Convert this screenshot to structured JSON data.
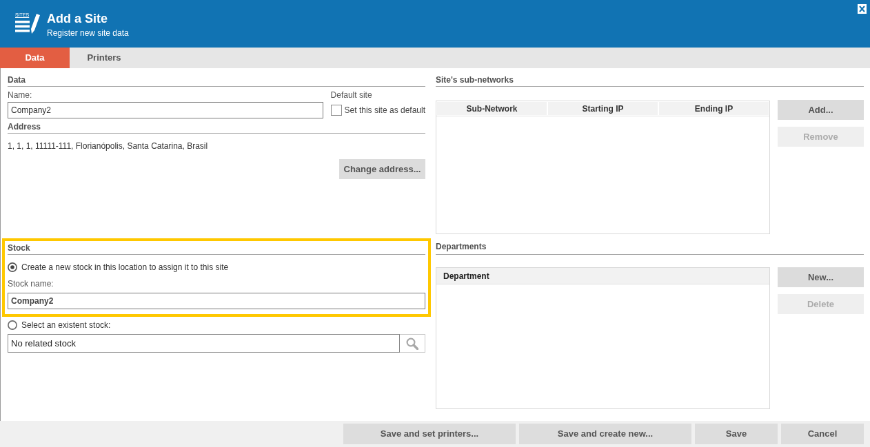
{
  "window": {
    "title": "Add a Site",
    "subtitle": "Register new site data",
    "icon_caption": "SITES"
  },
  "tabs": [
    {
      "label": "Data",
      "selected": true
    },
    {
      "label": "Printers",
      "selected": false
    }
  ],
  "data_section": {
    "heading": "Data",
    "name": {
      "label": "Name:",
      "value": "Company2"
    },
    "default_site": {
      "heading": "Default site",
      "label": "Set this site as default",
      "checked": false
    }
  },
  "address_section": {
    "heading": "Address",
    "text": "1, 1, 1, 11111-111, Florianópolis, Santa Catarina, Brasil",
    "button": "Change address..."
  },
  "stock_section": {
    "heading": "Stock",
    "highlighted": true,
    "options": [
      {
        "kind": "new",
        "label": "Create a new stock in this location to assign it to this site",
        "selected": true,
        "field": {
          "label": "Stock name:",
          "value": "Company2"
        }
      },
      {
        "kind": "existing",
        "label": "Select an existent stock:",
        "selected": false,
        "field": {
          "value": "No related stock"
        }
      }
    ]
  },
  "subnetworks": {
    "heading": "Site's sub-networks",
    "columns": [
      "Sub-Network",
      "Starting IP",
      "Ending IP"
    ],
    "buttons": [
      {
        "label": "Add...",
        "disabled": false
      },
      {
        "label": "Remove",
        "disabled": true
      }
    ]
  },
  "departments": {
    "heading": "Departments",
    "columns": [
      "Department"
    ],
    "buttons": [
      {
        "label": "New...",
        "disabled": false
      },
      {
        "label": "Delete",
        "disabled": true
      }
    ]
  },
  "footer_buttons": [
    "Save and set printers...",
    "Save and create new...",
    "Save",
    "Cancel"
  ]
}
